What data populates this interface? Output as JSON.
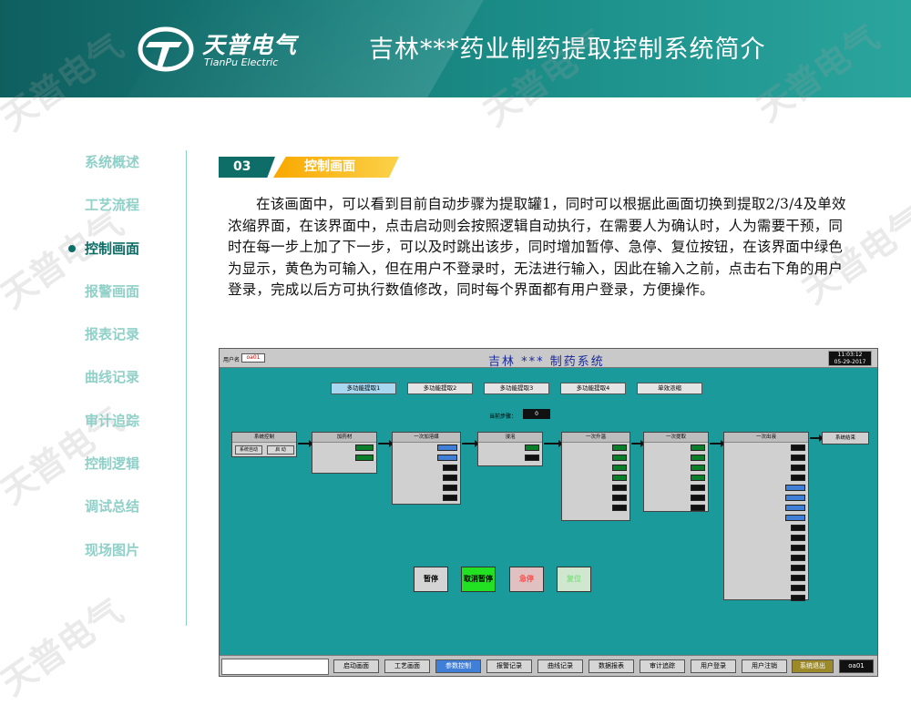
{
  "header": {
    "logo_cn": "天普电气",
    "logo_en": "TianPu Electric",
    "title": "吉林***药业制药提取控制系统简介"
  },
  "watermark": "天普电气",
  "sidebar": {
    "items": [
      "系统概述",
      "工艺流程",
      "控制画面",
      "报警画面",
      "报表记录",
      "曲线记录",
      "审计追踪",
      "控制逻辑",
      "调试总结",
      "现场图片"
    ],
    "active_index": 2
  },
  "section": {
    "number": "03",
    "title": "控制画面"
  },
  "body_text": "在该画面中，可以看到目前自动步骤为提取罐1，同时可以根据此画面切换到提取2/3/4及单效浓缩界面，在该界面中，点击启动则会按照逻辑自动执行，在需要人为确认时，人为需要干预，同时在每一步上加了下一步，可以及时跳出该步，同时增加暂停、急停、复位按钮，在该界面中绿色为显示，黄色为可输入，但在用户不登录时，无法进行输入，因此在输入之前，点击右下角的用户登录，完成以后方可执行数值修改，同时每个界面都有用户登录，方便操作。",
  "scada": {
    "user_label": "用户名",
    "user_value": "oa01",
    "title": "吉林  *** 制药系统",
    "clock_time": "11:03:12",
    "clock_date": "05-29-2017",
    "tabs": [
      "多功能提取1",
      "多功能提取2",
      "多功能提取3",
      "多功能提取4",
      "单效浓缩"
    ],
    "current_step_label": "当前步骤：",
    "current_step_value": "0",
    "blocks": {
      "system": "系统控制",
      "add": "加药材",
      "water": "一次加溶媒",
      "steam": "浸泡",
      "heat": "一次升温",
      "keep": "一次提取",
      "out": "一次出液",
      "end": "系统结束"
    },
    "buttons": {
      "sys_auto": "系统自动",
      "start": "启 动",
      "confirm": "确 认",
      "next": "下一步"
    },
    "big_buttons": {
      "pause": "暂停",
      "cancel_pause": "取消暂停",
      "estop": "急停",
      "reset": "复位"
    },
    "nav": [
      "启动画面",
      "工艺画面",
      "参数控制",
      "报警记录",
      "曲线记录",
      "数据报表",
      "审计追踪",
      "用户登录",
      "用户注销",
      "系统退出"
    ],
    "nav_user": "oa01",
    "colors": {
      "panel": "#1a9a9a",
      "display": "#0a7f2a",
      "input": "#f5d000"
    }
  }
}
